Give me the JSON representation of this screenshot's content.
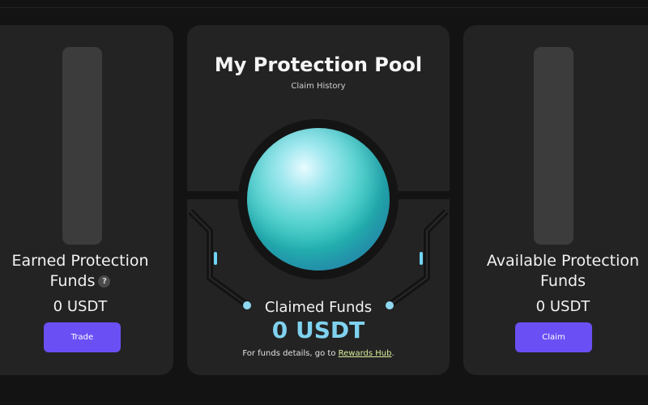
{
  "left_card": {
    "title_line1": "Earned Protection",
    "title_line2": "Funds",
    "help_label": "?",
    "amount": "0 USDT",
    "button_label": "Trade"
  },
  "center_card": {
    "title": "My Protection Pool",
    "subtitle": "Claim History",
    "claimed_label": "Claimed Funds",
    "claimed_amount": "0 USDT",
    "footnote_prefix": "For funds details, go to ",
    "footnote_link": "Rewards Hub",
    "footnote_suffix": "."
  },
  "right_card": {
    "title_line1": "Available Protection",
    "title_line2": "Funds",
    "amount": "0 USDT",
    "button_label": "Claim"
  },
  "colors": {
    "background": "#131313",
    "card": "#232323",
    "button": "#6a4ff5",
    "link": "#d8ef9a",
    "accent_amount": "#7fd2ef",
    "orb": "#3cc6c6"
  }
}
